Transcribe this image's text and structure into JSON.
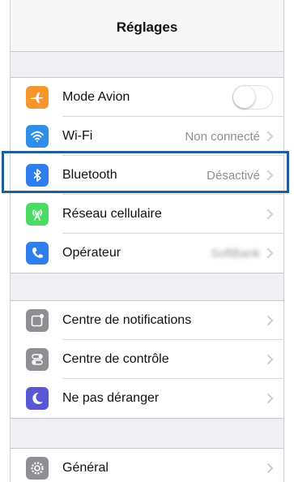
{
  "header": {
    "title": "Réglages"
  },
  "groups": [
    {
      "items": [
        {
          "label": "Mode Avion",
          "icon": "airplane-icon",
          "color": "#f7962a",
          "toggle": false
        },
        {
          "label": "Wi-Fi",
          "icon": "wifi-icon",
          "color": "#2f8ee8",
          "value": "Non connecté"
        },
        {
          "label": "Bluetooth",
          "icon": "bluetooth-icon",
          "color": "#2f7ef0",
          "value": "Désactivé",
          "highlighted": true
        },
        {
          "label": "Réseau cellulaire",
          "icon": "cellular-icon",
          "color": "#4cd964"
        },
        {
          "label": "Opérateur",
          "icon": "phone-icon",
          "color": "#2f7ef0",
          "value": "SoftBank",
          "value_blurred": true
        }
      ]
    },
    {
      "items": [
        {
          "label": "Centre de notifications",
          "icon": "notifications-icon",
          "color": "#8e8e93"
        },
        {
          "label": "Centre de contrôle",
          "icon": "control-center-icon",
          "color": "#8e8e93"
        },
        {
          "label": "Ne pas déranger",
          "icon": "moon-icon",
          "color": "#5856d6"
        }
      ]
    },
    {
      "items": [
        {
          "label": "Général",
          "icon": "gear-icon",
          "color": "#8e8e93"
        }
      ]
    }
  ]
}
